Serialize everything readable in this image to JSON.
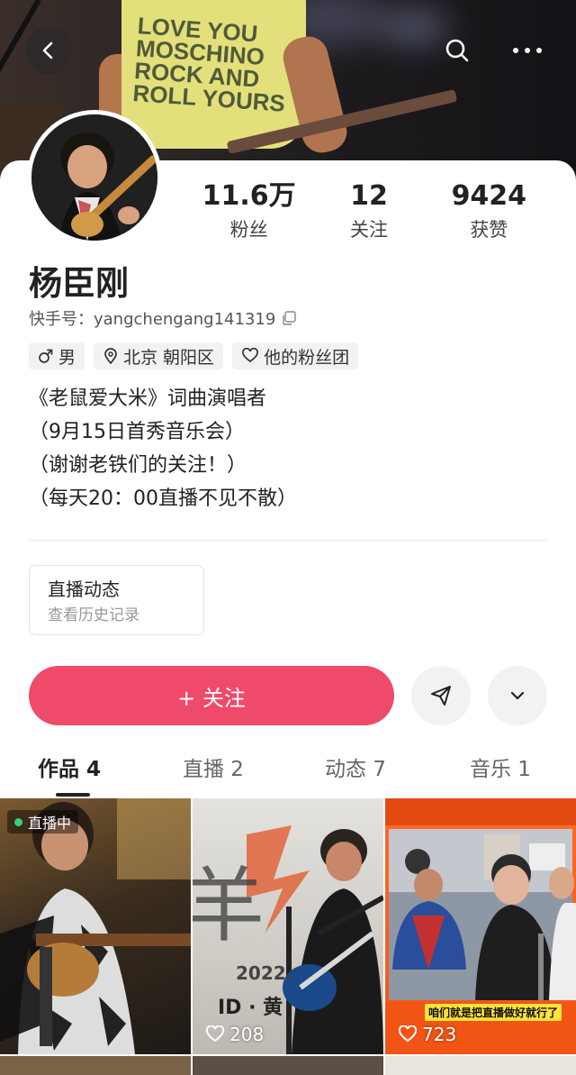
{
  "profile": {
    "name": "杨臣刚",
    "kuaishou_id": "快手号：yangchengang141319"
  },
  "cover": {
    "shirt_text": "LOVE YOU MOSCHINO ROCK AND ROLL YOURS"
  },
  "stats": [
    {
      "value": "11.6万",
      "label": "粉丝"
    },
    {
      "value": "12",
      "label": "关注"
    },
    {
      "value": "9424",
      "label": "获赞"
    }
  ],
  "tags": {
    "gender": "男",
    "location": "北京 朝阳区",
    "fan_group": "他的粉丝团"
  },
  "bio": [
    "《老鼠爱大米》词曲演唱者",
    "（9月15日首秀音乐会）",
    "（谢谢老铁们的关注！）",
    "（每天20：00直播不见不散）"
  ],
  "live_card": {
    "title": "直播动态",
    "subtitle": "查看历史记录"
  },
  "actions": {
    "follow_label": "+ 关注"
  },
  "tabs": [
    {
      "label": "作品 4",
      "active": true
    },
    {
      "label": "直播 2",
      "active": false
    },
    {
      "label": "动态 7",
      "active": false
    },
    {
      "label": "音乐 1",
      "active": false
    }
  ],
  "works": [
    {
      "badge": "直播中",
      "likes": ""
    },
    {
      "badge": "",
      "likes": "208",
      "poster_text": "2022.",
      "poster_sub": "ID · 黄"
    },
    {
      "badge": "",
      "likes": "723",
      "caption": "咱们就是把直播做好就行了"
    }
  ],
  "colors": {
    "accent": "#ef4a6a",
    "live_dot": "#35d07f"
  }
}
